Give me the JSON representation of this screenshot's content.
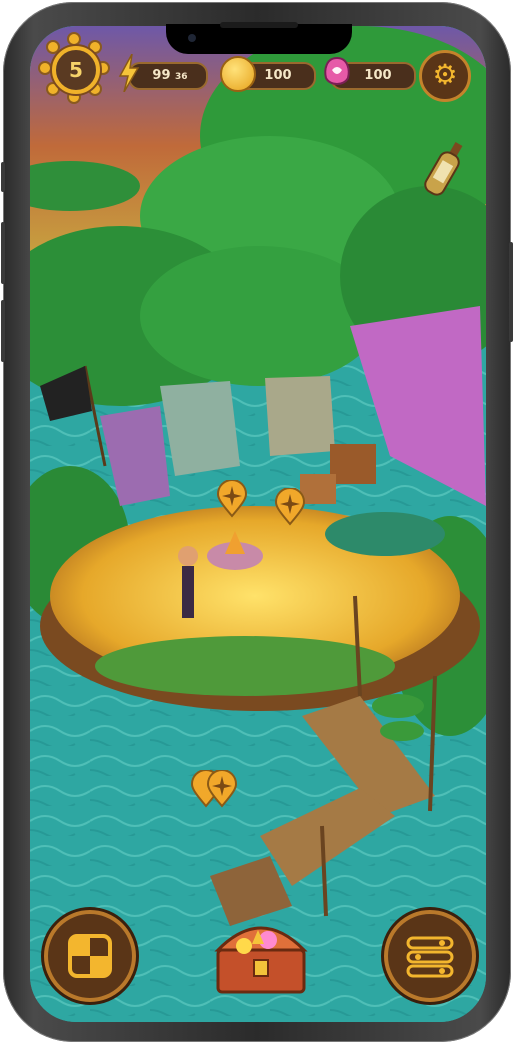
{
  "hud": {
    "level": "5",
    "energy": {
      "value": "99",
      "sub": "36"
    },
    "coins": "100",
    "gems": "100"
  },
  "colors": {
    "water": "#2fa7a3",
    "wood": "#5a3517",
    "gold": "#f0b22a",
    "foliage": "#2f9a3a"
  },
  "icons": {
    "settings": "gear-icon",
    "energy": "lightning-icon",
    "coins": "coin-icon",
    "gems": "shell-gem-icon",
    "bottle": "message-bottle-icon",
    "left_button": "board-grid-icon",
    "center_button": "treasure-chest-icon",
    "right_button": "list-menu-icon"
  }
}
